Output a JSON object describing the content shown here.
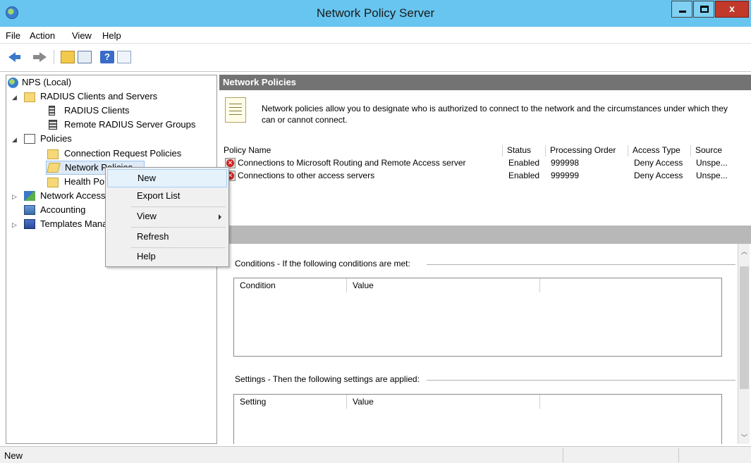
{
  "window": {
    "title": "Network Policy Server",
    "minimize_glyph": "",
    "close_glyph": "x"
  },
  "menubar": [
    "File",
    "Action",
    "View",
    "Help"
  ],
  "toolbar": {
    "help_glyph": "?"
  },
  "tree": {
    "root": "NPS (Local)",
    "radius_group": "RADIUS Clients and Servers",
    "radius_clients": "RADIUS Clients",
    "remote_groups": "Remote RADIUS Server Groups",
    "policies": "Policies",
    "connection_request": "Connection Request Policies",
    "network_policies": "Network Policies",
    "health_policies": "Health Policies",
    "network_access": "Network Access Protection",
    "accounting": "Accounting",
    "templates": "Templates Management"
  },
  "context_menu": {
    "items": [
      "New",
      "Export List",
      "View",
      "Refresh",
      "Help"
    ]
  },
  "right_pane": {
    "header": "Network Policies",
    "description": "Network policies allow you to designate who is authorized to connect to the network and the circumstances under which they can or cannot connect.",
    "columns": [
      "Policy Name",
      "Status",
      "Processing Order",
      "Access Type",
      "Source"
    ],
    "rows": [
      {
        "name": "Connections to Microsoft Routing and Remote Access server",
        "status": "Enabled",
        "order": "999998",
        "access": "Deny Access",
        "source": "Unspe..."
      },
      {
        "name": "Connections to other access servers",
        "status": "Enabled",
        "order": "999999",
        "access": "Deny Access",
        "source": "Unspe..."
      }
    ],
    "conditions_label": "Conditions - If the following conditions are met:",
    "conditions_columns": [
      "Condition",
      "Value"
    ],
    "settings_label": "Settings - Then the following settings are applied:",
    "settings_columns": [
      "Setting",
      "Value"
    ]
  },
  "statusbar": {
    "text": "New"
  }
}
